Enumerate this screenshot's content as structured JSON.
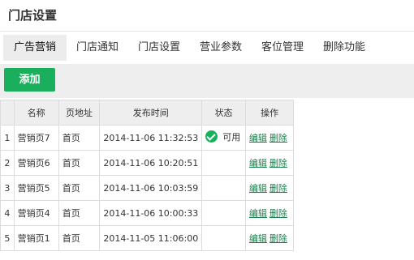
{
  "page": {
    "title": "门店设置"
  },
  "tabs": [
    {
      "label": "广告营销",
      "active": true
    },
    {
      "label": "门店通知",
      "active": false
    },
    {
      "label": "门店设置",
      "active": false
    },
    {
      "label": "营业参数",
      "active": false
    },
    {
      "label": "客位管理",
      "active": false
    },
    {
      "label": "删除功能",
      "active": false
    }
  ],
  "toolbar": {
    "add_label": "添加"
  },
  "table": {
    "headers": {
      "index": "",
      "name": "名称",
      "page": "页地址",
      "time": "发布时间",
      "status": "状态",
      "ops": "操作"
    },
    "rows": [
      {
        "index": "1",
        "name": "营销页7",
        "page": "首页",
        "time": "2014-11-06 11:32:53",
        "status": "可用",
        "edit": "编辑",
        "delete": "删除"
      },
      {
        "index": "2",
        "name": "营销页6",
        "page": "首页",
        "time": "2014-11-06 10:20:51",
        "status": "",
        "edit": "编辑",
        "delete": "删除"
      },
      {
        "index": "3",
        "name": "营销页5",
        "page": "首页",
        "time": "2014-11-06 10:03:59",
        "status": "",
        "edit": "编辑",
        "delete": "删除"
      },
      {
        "index": "4",
        "name": "营销页4",
        "page": "首页",
        "time": "2014-11-06 10:00:33",
        "status": "",
        "edit": "编辑",
        "delete": "删除"
      },
      {
        "index": "5",
        "name": "营销页1",
        "page": "首页",
        "time": "2014-11-05 11:06:00",
        "status": "",
        "edit": "编辑",
        "delete": "删除"
      }
    ]
  },
  "colors": {
    "accent": "#1aaf5d",
    "link": "#1a7f4b",
    "header_bg": "#eeeeee",
    "active_tab_bg": "#ececec"
  },
  "icons": {
    "status_ok": "check-circle-icon"
  }
}
